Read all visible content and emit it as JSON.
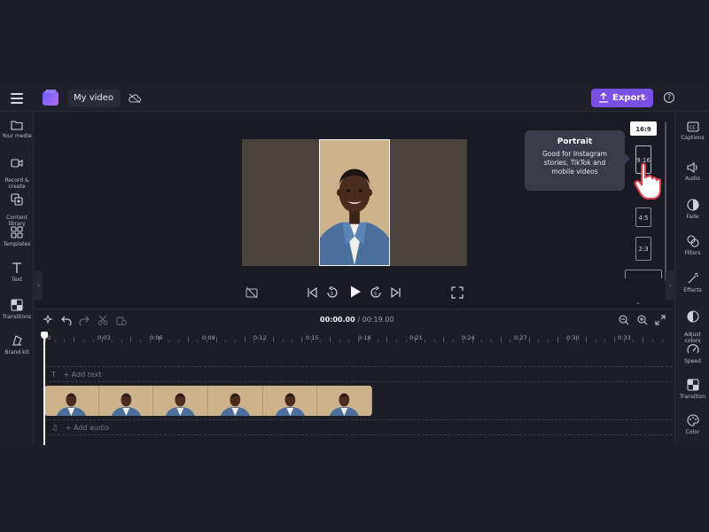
{
  "topbar": {
    "project_title": "My video",
    "export_label": "Export",
    "export_chevron": "⌵",
    "help": "?"
  },
  "left_sidebar": {
    "items": [
      {
        "label": "Your media",
        "icon": "folder-icon"
      },
      {
        "label": "Record &\ncreate",
        "icon": "camera-icon"
      },
      {
        "label": "Content\nlibrary",
        "icon": "library-icon"
      },
      {
        "label": "Templates",
        "icon": "templates-icon"
      },
      {
        "label": "Text",
        "icon": "text-icon"
      },
      {
        "label": "Transitions",
        "icon": "transitions-icon"
      },
      {
        "label": "Brand kit",
        "icon": "brand-kit-icon"
      }
    ]
  },
  "right_sidebar": {
    "items": [
      {
        "label": "Captions",
        "icon": "captions-icon"
      },
      {
        "label": "Audio",
        "icon": "speaker-icon"
      },
      {
        "label": "Fade",
        "icon": "fade-icon"
      },
      {
        "label": "Filters",
        "icon": "filters-icon"
      },
      {
        "label": "Effects",
        "icon": "magic-wand-icon"
      },
      {
        "label": "Adjust\ncolors",
        "icon": "adjust-icon"
      },
      {
        "label": "Speed",
        "icon": "speedometer-icon"
      },
      {
        "label": "Transition",
        "icon": "transition-icon"
      },
      {
        "label": "Color",
        "icon": "palette-icon"
      }
    ]
  },
  "aspect_ratios": {
    "options": [
      "16:9",
      "9:16",
      "4:5",
      "2:3"
    ],
    "selected": "16:9",
    "hovered": "9:16"
  },
  "tooltip": {
    "title": "Portrait",
    "description": "Good for Instagram stories, TikTok and mobile videos"
  },
  "timeline": {
    "current_time": "00:00.00",
    "total_time": "/ 00:19.00",
    "ruler_labels": [
      "0",
      "0:03",
      "0:06",
      "0:09",
      "0:12",
      "0:15",
      "0:18",
      "0:21",
      "0:24",
      "0:27",
      "0:30",
      "0:33"
    ],
    "text_track_placeholder": "+ Add text",
    "audio_track_placeholder": "+ Add audio",
    "text_track_icon": "T",
    "audio_track_icon": "♫"
  },
  "colors": {
    "accent": "#7b4fe6",
    "background": "#1f1f29",
    "canvas_side": "#4a433c",
    "canvas_mid": "#cdb38c"
  }
}
